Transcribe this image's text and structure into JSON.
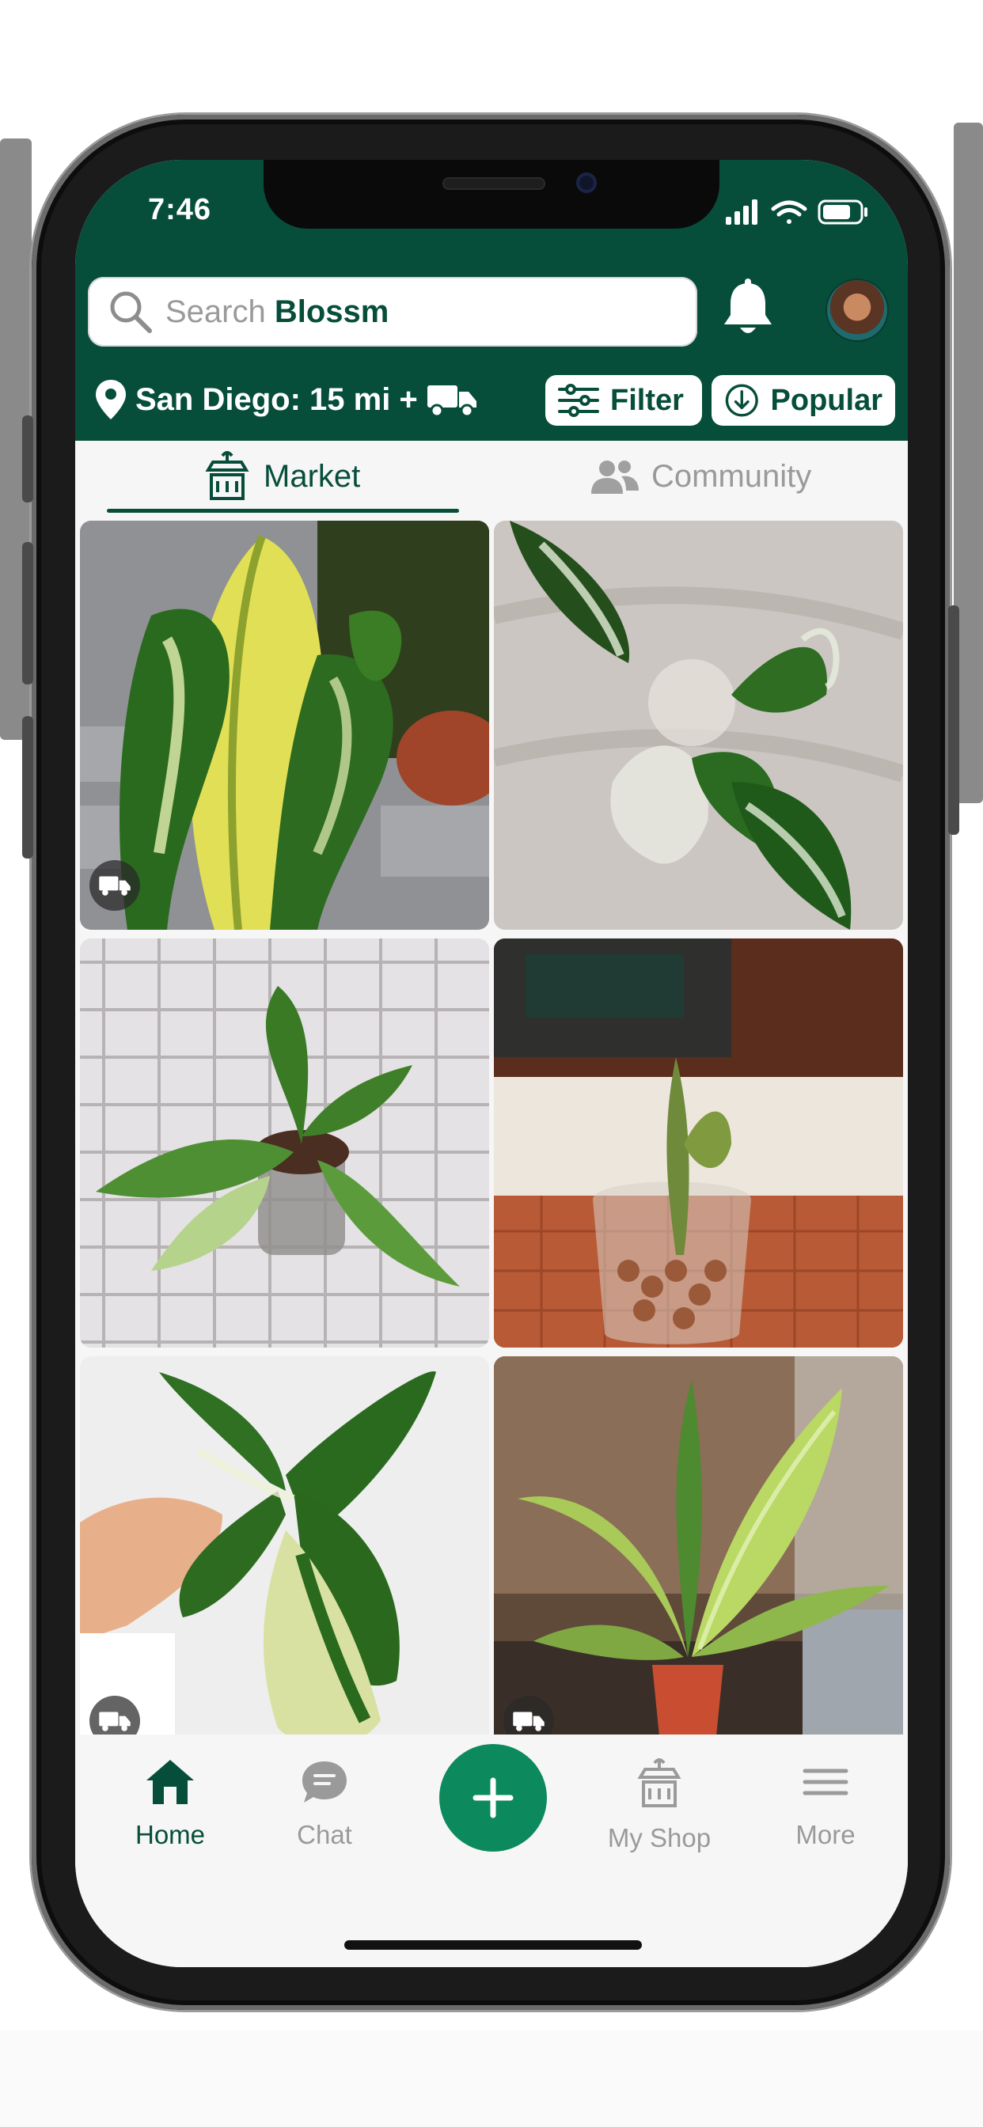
{
  "status_bar": {
    "time": "7:46",
    "icons": [
      "signal-icon",
      "wifi-icon",
      "battery-icon"
    ]
  },
  "header": {
    "search": {
      "placeholder_prefix": "Search",
      "brand": "Blossm"
    },
    "location": "San Diego: 15 mi +",
    "filter_label": "Filter",
    "sort_label": "Popular"
  },
  "tabs": [
    {
      "label": "Market",
      "active": true
    },
    {
      "label": "Community",
      "active": false
    }
  ],
  "listings": [
    {
      "subject": "variegated plant, yellow and green leaves",
      "shipping": true
    },
    {
      "subject": "variegated plant on fabric",
      "shipping": false
    },
    {
      "subject": "plant in glass cup on hexagon tile",
      "shipping": false
    },
    {
      "subject": "cutting in glass jar with clay balls",
      "shipping": false
    },
    {
      "subject": "variegated leaf held in hand",
      "shipping": true
    },
    {
      "subject": "large-leaf plant in red pot",
      "shipping": true
    }
  ],
  "nav": {
    "home": "Home",
    "chat": "Chat",
    "add": "+",
    "shop": "My Shop",
    "more": "More"
  },
  "colors": {
    "brand_green": "#064e3a",
    "accent_green": "#0c8a5e"
  }
}
